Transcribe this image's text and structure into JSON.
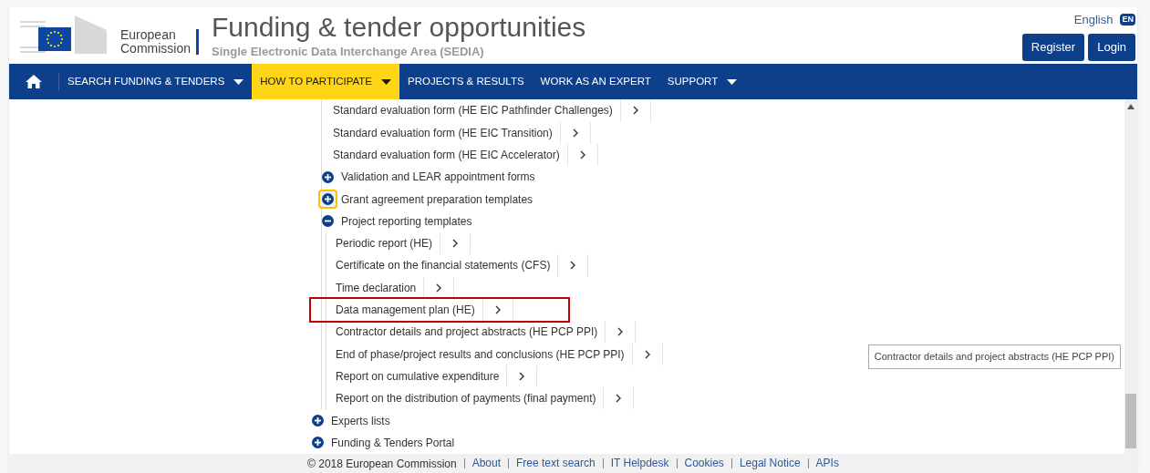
{
  "header": {
    "org_line1": "European",
    "org_line2": "Commission",
    "title": "Funding & tender opportunities",
    "subtitle": "Single Electronic Data Interchange Area (SEDIA)",
    "language": "English",
    "language_badge": "EN",
    "buttons": [
      "Register",
      "Login"
    ]
  },
  "nav": [
    {
      "label": "SEARCH FUNDING & TENDERS",
      "caret": true,
      "selected": false
    },
    {
      "label": "HOW TO PARTICIPATE",
      "caret": true,
      "selected": true
    },
    {
      "label": "PROJECTS & RESULTS",
      "caret": false,
      "selected": false
    },
    {
      "label": "WORK AS AN EXPERT",
      "caret": false,
      "selected": false
    },
    {
      "label": "SUPPORT",
      "caret": true,
      "selected": false
    }
  ],
  "tree": [
    {
      "kind": "continued",
      "children": [
        {
          "kind": "link",
          "label": "Standard evaluation form (HE EIC Pathfinder Challenges)",
          "highlighted": false
        },
        {
          "kind": "link",
          "label": "Standard evaluation form (HE EIC Transition)",
          "highlighted": false
        },
        {
          "kind": "link",
          "label": "Standard evaluation form (HE EIC Accelerator)",
          "highlighted": false
        },
        {
          "kind": "group",
          "label": "Validation and LEAR appointment forms",
          "expanded": false,
          "focused": false
        },
        {
          "kind": "group",
          "label": "Grant agreement preparation templates",
          "expanded": false,
          "focused": true
        },
        {
          "kind": "group",
          "label": "Project reporting templates",
          "expanded": true,
          "focused": false,
          "children": [
            {
              "kind": "link",
              "label": "Periodic report (HE)",
              "highlighted": false
            },
            {
              "kind": "link",
              "label": "Certificate on the financial statements (CFS)",
              "highlighted": false
            },
            {
              "kind": "link",
              "label": "Time declaration",
              "highlighted": false
            },
            {
              "kind": "link",
              "label": "Data management plan (HE)",
              "highlighted": true
            },
            {
              "kind": "link",
              "label": "Contractor details and project abstracts (HE PCP PPI)",
              "highlighted": false
            },
            {
              "kind": "link",
              "label": "End of phase/project results and conclusions (HE PCP PPI)",
              "highlighted": false
            },
            {
              "kind": "link",
              "label": "Report on cumulative expenditure",
              "highlighted": false
            },
            {
              "kind": "link",
              "label": "Report on the distribution of payments (final payment)",
              "highlighted": false
            }
          ]
        }
      ]
    },
    {
      "kind": "group",
      "label": "Experts lists",
      "expanded": false,
      "focused": false
    },
    {
      "kind": "group",
      "label": "Funding & Tenders Portal",
      "expanded": false,
      "focused": false
    }
  ],
  "tooltip": "Contractor details and project abstracts (HE PCP PPI)",
  "footer": {
    "copyright": "© 2018 European Commission",
    "links": [
      "About",
      "Free text search",
      "IT Helpdesk",
      "Cookies",
      "Legal Notice",
      "APIs"
    ]
  }
}
